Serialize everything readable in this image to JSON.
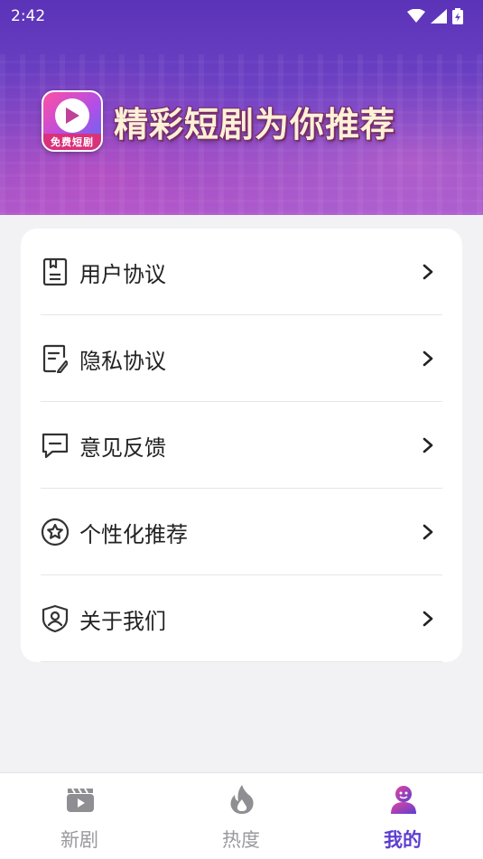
{
  "status_bar": {
    "time": "2:42"
  },
  "banner": {
    "logo_label": "免费短剧",
    "title": "精彩短剧为你推荐"
  },
  "menu": {
    "items": [
      {
        "label": "用户协议",
        "icon": "document-icon"
      },
      {
        "label": "隐私协议",
        "icon": "edit-document-icon"
      },
      {
        "label": "意见反馈",
        "icon": "message-icon"
      },
      {
        "label": "个性化推荐",
        "icon": "star-circle-icon"
      },
      {
        "label": "关于我们",
        "icon": "shield-user-icon"
      }
    ]
  },
  "tabbar": {
    "tabs": [
      {
        "label": "新剧",
        "icon": "clapperboard-icon",
        "active": false
      },
      {
        "label": "热度",
        "icon": "flame-icon",
        "active": false
      },
      {
        "label": "我的",
        "icon": "user-icon",
        "active": true
      }
    ]
  },
  "colors": {
    "accent": "#5d3ed1",
    "header": "#6a3fc2",
    "tab_inactive": "#9a9a9e"
  }
}
